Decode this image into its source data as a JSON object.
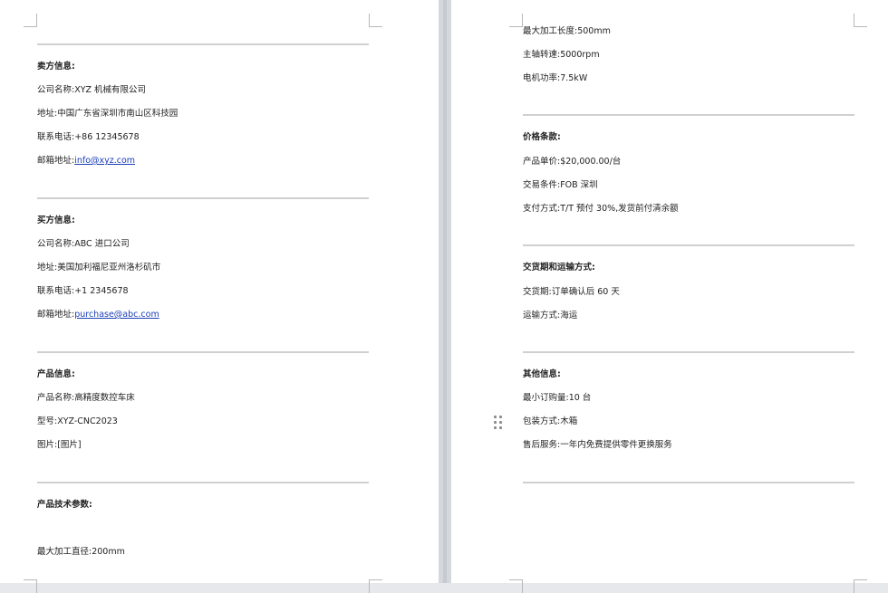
{
  "left": {
    "seller": {
      "heading": "卖方信息:",
      "company_label": "公司名称:",
      "company": "XYZ 机械有限公司",
      "address_label": "地址:",
      "address": "中国广东省深圳市南山区科技园",
      "phone_label": "联系电话:",
      "phone": "+86 12345678",
      "email_label": "邮箱地址:",
      "email": "info@xyz.com"
    },
    "buyer": {
      "heading": "买方信息:",
      "company_label": "公司名称:",
      "company": "ABC 进口公司",
      "address_label": "地址:",
      "address": "美国加利福尼亚州洛杉矶市",
      "phone_label": "联系电话:",
      "phone": "+1 2345678",
      "email_label": "邮箱地址:",
      "email": "purchase@abc.com"
    },
    "product": {
      "heading": "产品信息:",
      "name_label": "产品名称:",
      "name": "高精度数控车床",
      "model_label": "型号:",
      "model": "XYZ-CNC2023",
      "image_label": "图片:",
      "image": "[图片]"
    },
    "specs": {
      "heading": "产品技术参数:",
      "max_diameter_label": "最大加工直径:",
      "max_diameter": "200mm"
    }
  },
  "right": {
    "specs_cont": {
      "max_length_label": "最大加工长度:",
      "max_length": "500mm",
      "spindle_label": "主轴转速:",
      "spindle": "5000rpm",
      "motor_label": "电机功率:",
      "motor": "7.5kW"
    },
    "price": {
      "heading": "价格条款:",
      "unit_price_label": "产品单价:",
      "unit_price": "$20,000.00/台",
      "terms_label": "交易条件:",
      "terms": "FOB  深圳",
      "payment_label": "支付方式:",
      "payment": "T/T 预付 30%,发货前付清余额"
    },
    "delivery": {
      "heading": "交货期和运输方式:",
      "delivery_label": "交货期:",
      "delivery": "订单确认后 60 天",
      "transport_label": "运输方式:",
      "transport": "海运"
    },
    "other": {
      "heading": "其他信息:",
      "moq_label": "最小订购量:",
      "moq": "10 台",
      "packing_label": "包装方式:",
      "packing": "木箱",
      "service_label": "售后服务:",
      "service": "一年内免费提供零件更换服务"
    }
  }
}
